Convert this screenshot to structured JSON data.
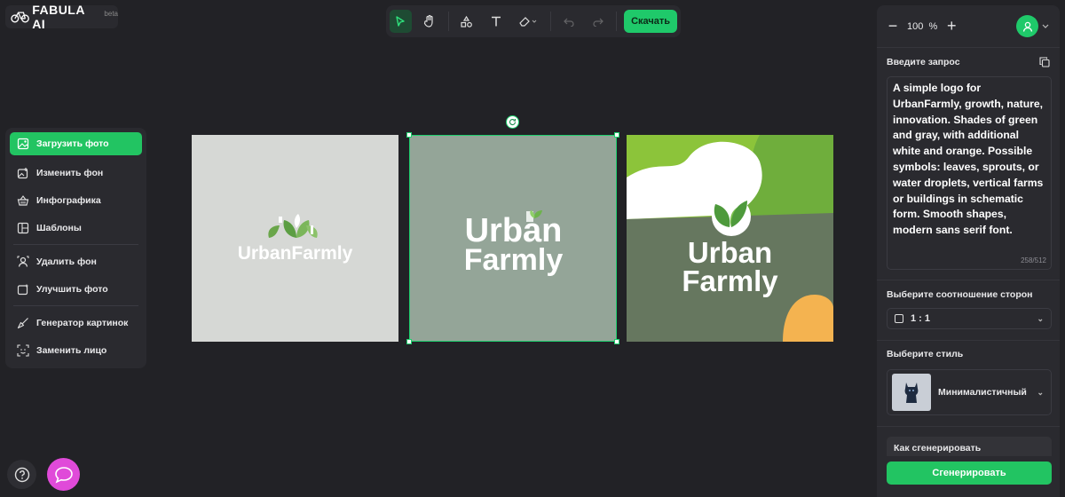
{
  "app": {
    "brand": "FABULA AI",
    "badge": "beta"
  },
  "toolbar": {
    "tools": [
      "select-cursor-icon",
      "hand-icon",
      "shapes-icon",
      "text-icon",
      "eraser-icon",
      "undo-icon",
      "redo-icon"
    ],
    "download_label": "Скачать",
    "accent": "#1fc96a"
  },
  "left_menu": {
    "items": [
      {
        "label": "Загрузить фото",
        "icon": "upload-image-icon",
        "active": true
      },
      {
        "label": "Изменить фон",
        "icon": "image-edit-icon"
      },
      {
        "label": "Инфографика",
        "icon": "basket-icon"
      },
      {
        "label": "Шаблоны",
        "icon": "templates-icon"
      },
      {
        "label": "Удалить фон",
        "icon": "remove-bg-icon"
      },
      {
        "label": "Улучшить фото",
        "icon": "enhance-icon"
      },
      {
        "label": "Генератор картинок",
        "icon": "brush-icon"
      },
      {
        "label": "Заменить лицо",
        "icon": "face-icon"
      }
    ]
  },
  "canvas": {
    "images": [
      {
        "text_1": "UrbanFarmly"
      },
      {
        "text_1": "Urban",
        "text_2": "Farmly",
        "selected": true
      },
      {
        "text_1": "Urban",
        "text_2": "Farmly"
      }
    ]
  },
  "right_panel": {
    "zoom": {
      "value": "100",
      "unit": "%",
      "minus": "−",
      "plus": "+"
    },
    "prompt": {
      "title": "Введите запрос",
      "text": "A simple logo for UrbanFarmly, growth, nature, innovation. Shades of green and gray, with additional white and orange. Possible symbols: leaves, sprouts, or water droplets, vertical farms or buildings in schematic form. Smooth shapes, modern sans serif font.",
      "counter": "258/512"
    },
    "aspect": {
      "title": "Выберите соотношение сторон",
      "value": "1 : 1"
    },
    "style": {
      "title": "Выберите стиль",
      "value": "Минималистичный"
    },
    "how_to": "Как сгенерировать",
    "generate_label": "Сгенерировать"
  },
  "bottom": {
    "help": "?"
  }
}
